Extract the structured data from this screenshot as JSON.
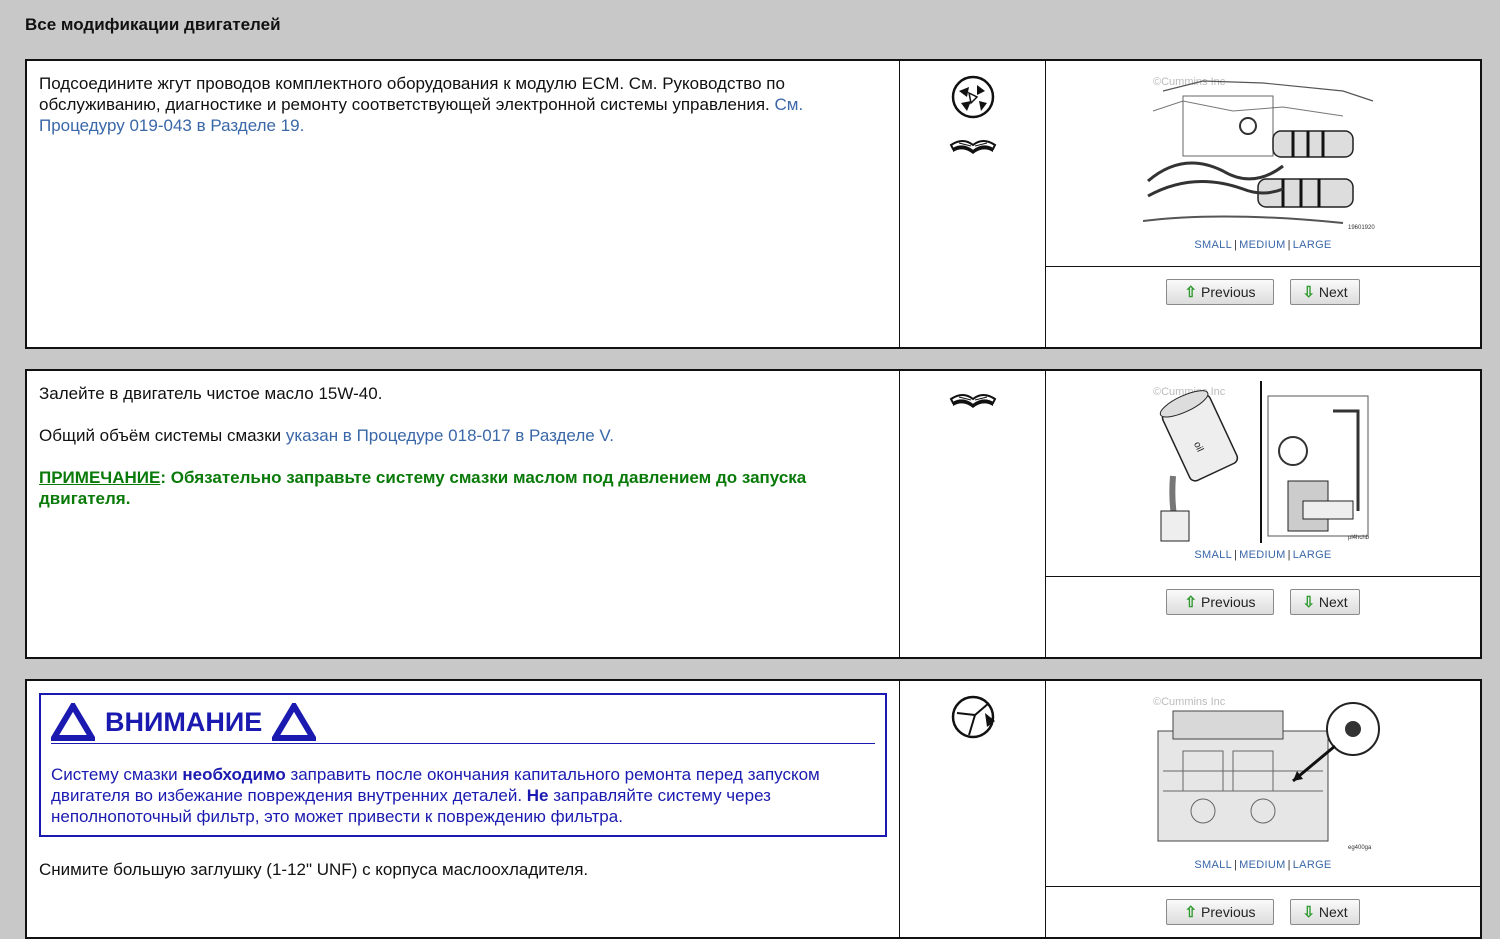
{
  "page": {
    "title": "Все модификации двигателей"
  },
  "media_common": {
    "size_small": "SMALL",
    "size_medium": "MEDIUM",
    "size_large": "LARGE",
    "previous_label": "Previous",
    "next_label": "Next",
    "watermark": "©Cummins Inc"
  },
  "step1": {
    "text_plain": "Подсоедините жгут проводов комплектного оборудования к модулю ECM. См. Руководство по обслуживанию, диагностике и ремонту соответствующей электронной системы управления.",
    "text_link": "См. Процедуру 019-043 в Разделе 19.",
    "icons": [
      "tool-assembly-icon",
      "book-icon"
    ],
    "figure_code": "19601920"
  },
  "step2": {
    "para1": "Залейте в двигатель чистое масло 15W-40.",
    "para2_plain": "Общий объём системы смазки",
    "para2_link": "указан в Процедуре 018-017 в Разделе V.",
    "note_label": "ПРИМЕЧАНИЕ",
    "note_text": ": Обязательно заправьте систему смазки маслом под давлением до запуска двигателя.",
    "icons": [
      "book-icon"
    ],
    "figure_code": "pl4hchb"
  },
  "step3": {
    "warning_title": "ВНИМАНИЕ",
    "warning_1": "Систему смазки",
    "warning_2": "необходимо",
    "warning_3": "заправить после окончания капитального ремонта перед запуском двигателя во избежание повреждения внутренних деталей.",
    "warning_4": "Не",
    "warning_5": "заправляйте систему через неполнопоточный фильтр, это может привести к повреждению фильтра.",
    "text": "Снимите большую заглушку (1-12\" UNF) с корпуса маслоохладителя.",
    "icons": [
      "wrench-socket-icon"
    ],
    "figure_code": "eg400ga"
  },
  "colors": {
    "link": "#3a67a8",
    "note": "#0a7a0a",
    "warning": "#1a1ab0",
    "button_arrow": "#2f9a2f"
  }
}
